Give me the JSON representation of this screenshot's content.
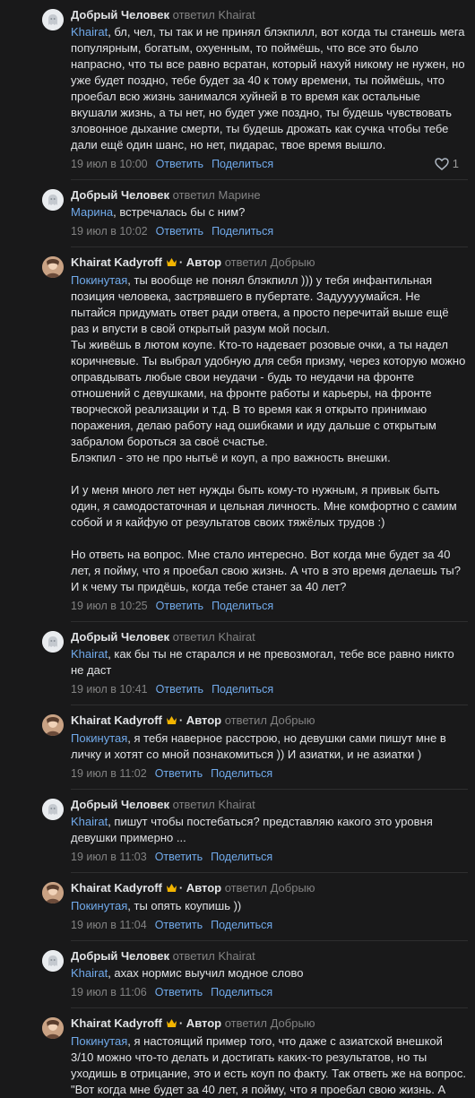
{
  "ui": {
    "reply_label": "Ответить",
    "share_label": "Поделиться",
    "replied_to_word": "ответил"
  },
  "comments": [
    {
      "author": "Добрый Человек",
      "replied_to": "Khairat",
      "mention": "Khairat",
      "text": ", бл, чел, ты так и не принял блэкпилл, вот когда ты станешь мега популярным, богатым, охуенным, то поймёшь, что все это было напрасно, что ты все равно всратан, который нахуй никому не нужен, но уже будет поздно, тебе будет за 40 к тому времени, ты поймёшь, что проебал всю жизнь занимался хуйней в то время как остальные вкушали жизнь, а ты нет, но будет уже поздно, ты будешь чувствовать зловонное дыхание смерти, ты будешь дрожать как сучка чтобы тебе дали ещё один шанс, но нет, пидарас, твое время вышло.",
      "date": "19 июл в 10:00",
      "likes": "1"
    },
    {
      "author": "Добрый Человек",
      "replied_to": "Марине",
      "mention": "Марина",
      "text": ", встречалась бы с ним?",
      "date": "19 июл в 10:02"
    },
    {
      "author": "Khairat Kadyroff",
      "badge": "· Автор",
      "replied_to": "Добрыю",
      "mention": "Покинутая",
      "text": ", ты вообще не понял блэкпилл ))) у тебя инфантильная позиция человека, застрявшего в пубертате. Задууууумайся. Не пытайся придумать ответ ради ответа, а просто перечитай выше ещё раз и впусти в свой открытый разум мой посыл.\nТы живёшь в лютом коупе. Кто-то надевает розовые очки, а ты надел коричневые. Ты выбрал удобную для себя призму, через которую можно оправдывать любые свои неудачи - будь то неудачи на фронте отношений с девушками, на фронте работы и карьеры, на фронте творческой реализации и т.д. В то время как я открыто принимаю поражения, делаю работу над ошибками и иду дальше с открытым забралом бороться за своё счастье.\nБлэкпил - это не про нытьё и коуп, а про важность внешки.\n\nИ у меня много лет нет нужды быть кому-то нужным, я привык быть один, я самодостаточная и цельная личность. Мне комфортно с самим собой и я кайфую от результатов своих тяжёлых трудов :)\n\nНо ответь на вопрос. Мне стало интересно. Вот когда мне будет за 40 лет, я пойму, что я проебал свою жизнь. А что в это время делаешь ты? И к чему ты придёшь, когда тебе станет за 40 лет?",
      "date": "19 июл в 10:25"
    },
    {
      "author": "Добрый Человек",
      "replied_to": "Khairat",
      "mention": "Khairat",
      "text": ", как бы ты не старался и не превозмогал, тебе все равно никто не даст",
      "date": "19 июл в 10:41"
    },
    {
      "author": "Khairat Kadyroff",
      "badge": "· Автор",
      "replied_to": "Добрыю",
      "mention": "Покинутая",
      "text": ", я тебя наверное расстрою, но девушки сами пишут мне в личку и хотят со мной познакомиться )) И азиатки, и не азиатки )",
      "date": "19 июл в 11:02"
    },
    {
      "author": "Добрый Человек",
      "replied_to": "Khairat",
      "mention": "Khairat",
      "text": ", пишут чтобы постебаться? представляю какого это уровня девушки примерно ...",
      "date": "19 июл в 11:03"
    },
    {
      "author": "Khairat Kadyroff",
      "badge": "· Автор",
      "replied_to": "Добрыю",
      "mention": "Покинутая",
      "text": ", ты опять коупишь ))",
      "date": "19 июл в 11:04"
    },
    {
      "author": "Добрый Человек",
      "replied_to": "Khairat",
      "mention": "Khairat",
      "text": ", ахах нормис выучил модное слово",
      "date": "19 июл в 11:06"
    },
    {
      "author": "Khairat Kadyroff",
      "badge": "· Автор",
      "replied_to": "Добрыю",
      "mention": "Покинутая",
      "text": ", я настоящий пример того, что даже с азиатской внешкой 3/10 можно что-то делать и достигать каких-то результатов, но ты уходишь в отрицание, это и есть коуп по факту. Так ответь же на вопрос.\n\"Вот когда мне будет за 40 лет, я пойму, что я проебал свою жизнь. А",
      "date": ""
    }
  ]
}
